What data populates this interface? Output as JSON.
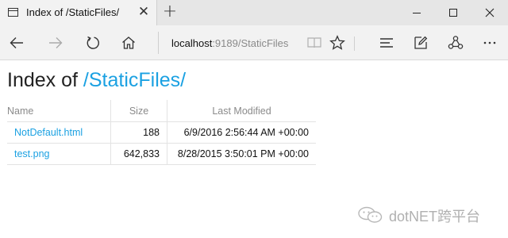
{
  "browser": {
    "tab": {
      "title": "Index of /StaticFiles/",
      "close_glyph": "✕"
    },
    "new_tab_glyph": "+",
    "address": {
      "host": "localhost",
      "rest": ":9189/StaticFiles"
    }
  },
  "page": {
    "heading_prefix": "Index of ",
    "heading_path": "/StaticFiles/",
    "columns": {
      "name": "Name",
      "size": "Size",
      "modified": "Last Modified"
    },
    "rows": [
      {
        "name": "NotDefault.html",
        "size": "188",
        "modified": "6/9/2016 2:56:44 AM +00:00"
      },
      {
        "name": "test.png",
        "size": "642,833",
        "modified": "8/28/2015 3:50:01 PM +00:00"
      }
    ]
  },
  "watermark": {
    "text": "dotNET跨平台"
  },
  "colors": {
    "link": "#1ba1e2",
    "tabstrip": "#e6e6e6",
    "toolbar": "#f2f2f2"
  },
  "icons": [
    "tab-page-icon",
    "close-icon",
    "new-tab-icon",
    "minimize-icon",
    "maximize-icon",
    "back-arrow-icon",
    "forward-arrow-icon",
    "refresh-icon",
    "home-icon",
    "reading-view-icon",
    "favorite-star-icon",
    "hub-icon",
    "web-note-icon",
    "share-icon",
    "wechat-logo-icon"
  ]
}
